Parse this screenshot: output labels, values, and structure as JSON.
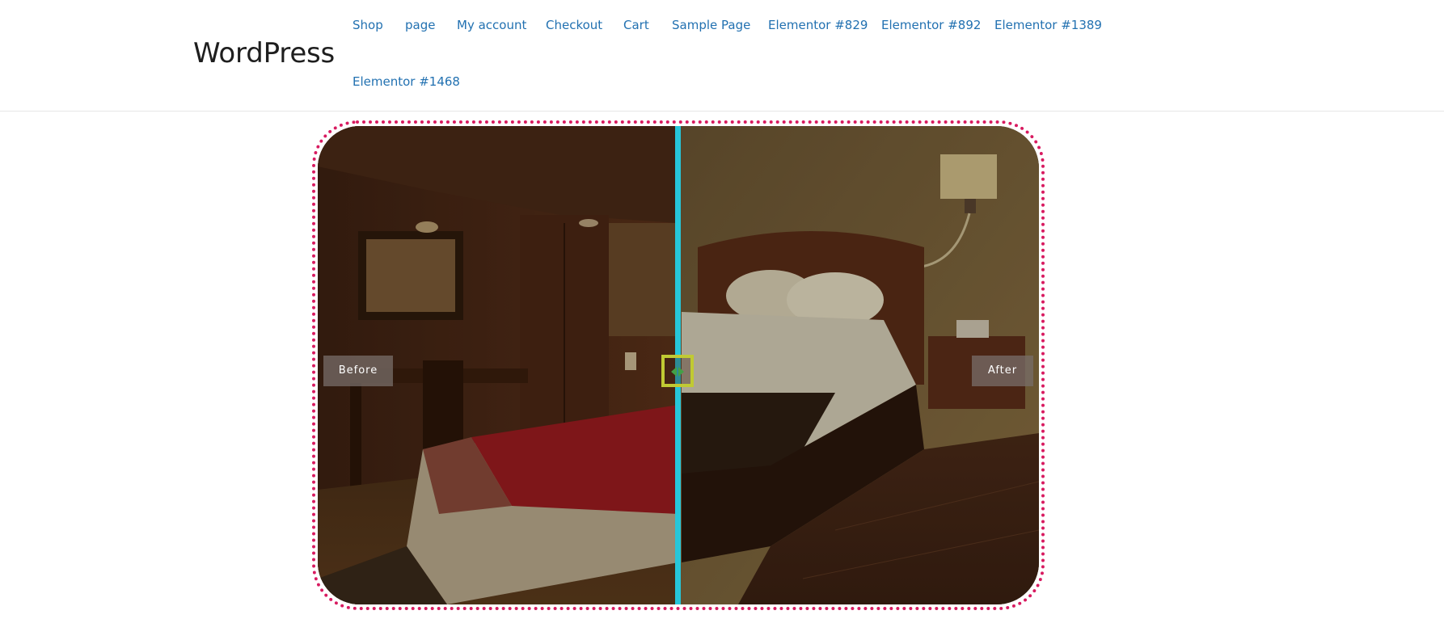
{
  "header": {
    "site_title": "WordPress",
    "nav": [
      {
        "label": "Shop"
      },
      {
        "label": "page"
      },
      {
        "label": "My account"
      },
      {
        "label": "Checkout"
      },
      {
        "label": "Cart"
      },
      {
        "label": "Sample Page"
      },
      {
        "label": "Elementor #829"
      },
      {
        "label": "Elementor #892"
      },
      {
        "label": "Elementor #1389"
      },
      {
        "label": "Elementor #1468"
      }
    ]
  },
  "comparison": {
    "before_label": "Before",
    "after_label": "After",
    "slider_position": 0.5,
    "colors": {
      "frame_border": "#d81b60",
      "divider": "#26c6da",
      "handle_border": "#c0ca33",
      "handle_arrows": "#43a047"
    },
    "icons": {
      "handle": "left-right-arrows-icon"
    }
  }
}
